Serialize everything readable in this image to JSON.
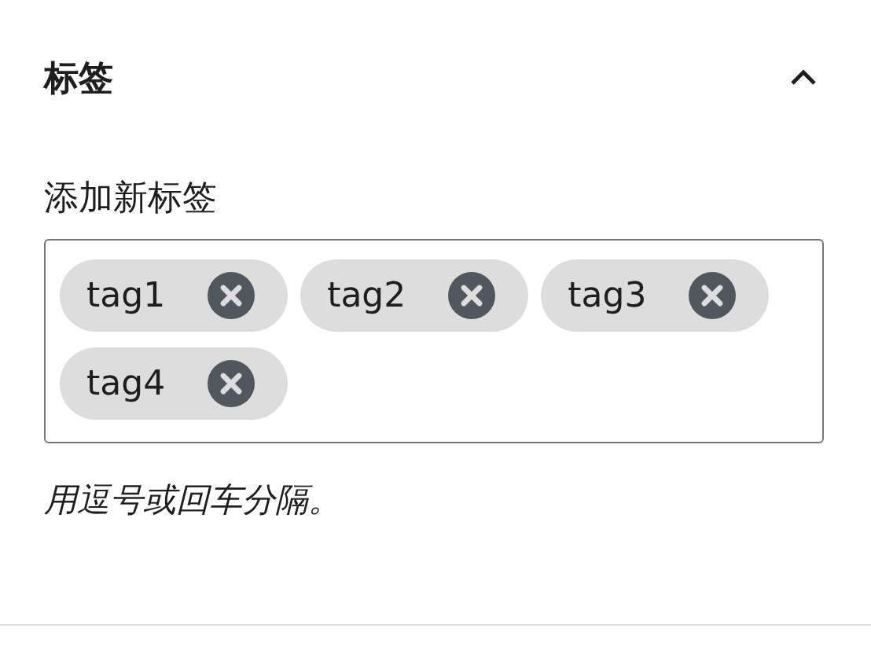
{
  "panel": {
    "title": "标签",
    "expanded": true
  },
  "field": {
    "label": "添加新标签",
    "tags": [
      {
        "label": "tag1"
      },
      {
        "label": "tag2"
      },
      {
        "label": "tag3"
      },
      {
        "label": "tag4"
      }
    ],
    "hint": "用逗号或回车分隔。"
  }
}
